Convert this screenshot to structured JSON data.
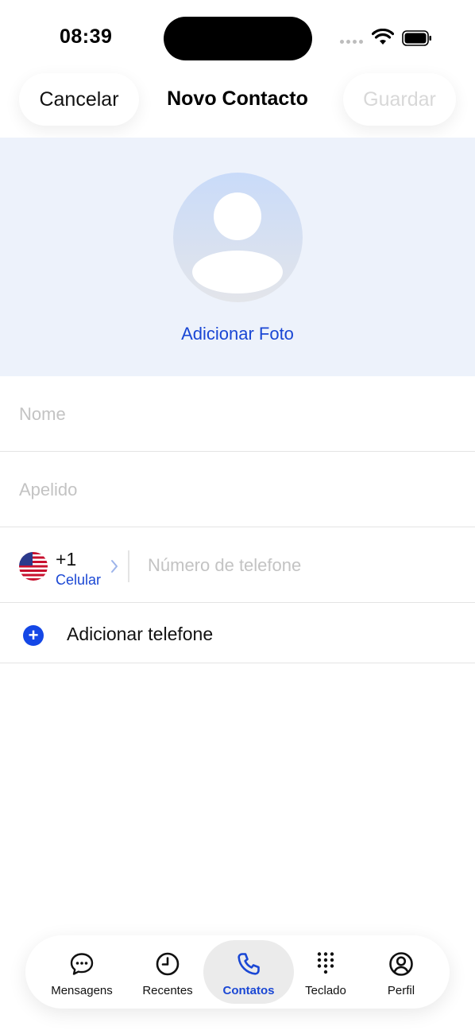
{
  "status_bar": {
    "time": "08:39"
  },
  "header": {
    "cancel_label": "Cancelar",
    "title": "Novo Contacto",
    "save_label": "Guardar"
  },
  "photo": {
    "add_label": "Adicionar Foto"
  },
  "form": {
    "first_name_placeholder": "Nome",
    "last_name_placeholder": "Apelido",
    "phone": {
      "country_code": "+1",
      "type_label": "Celular",
      "placeholder": "Número de telefone",
      "flag_icon": "us-flag-icon"
    },
    "add_phone_label": "Adicionar telefone"
  },
  "tabbar": {
    "accent_color": "#1a47d4",
    "tabs": [
      {
        "label": "Mensagens",
        "icon": "chat-bubble-icon",
        "active": false
      },
      {
        "label": "Recentes",
        "icon": "clock-icon",
        "active": false
      },
      {
        "label": "Contatos",
        "icon": "phone-icon",
        "active": true
      },
      {
        "label": "Teclado",
        "icon": "keypad-icon",
        "active": false
      },
      {
        "label": "Perfil",
        "icon": "user-circle-icon",
        "active": false
      }
    ]
  }
}
